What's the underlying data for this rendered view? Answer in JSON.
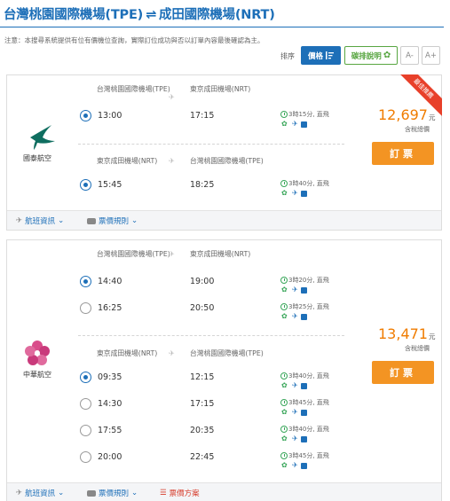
{
  "header": {
    "origin": "台灣桃園國際機場(TPE)",
    "swap_symbol": "⇌",
    "destination": "成田國際機場(NRT)"
  },
  "notice": "注意：本搜尋系統提供有位有價機位查詢，實際訂位成功與否以訂單內容最後確認為主。",
  "sort": {
    "label": "排序",
    "price_label": "價格",
    "eco_label": "碳排說明",
    "font_small": "A-",
    "font_large": "A+"
  },
  "results": [
    {
      "airline": "國泰航空",
      "ribbon": "最佳推薦",
      "price": "12,697",
      "currency": "元",
      "tax_note": "含稅總價",
      "book_label": "訂票",
      "outbound": {
        "from": "台灣桃園國際機場(TPE)",
        "to": "東京成田機場(NRT)",
        "options": [
          {
            "dep": "13:00",
            "arr": "17:15",
            "duration": "3時15分, 直飛",
            "selected": true
          }
        ]
      },
      "inbound": {
        "from": "東京成田機場(NRT)",
        "to": "台灣桃園國際機場(TPE)",
        "options": [
          {
            "dep": "15:45",
            "arr": "18:25",
            "duration": "3時40分, 直飛",
            "selected": true
          }
        ]
      },
      "footer": {
        "flight_info": "航班資訊",
        "fare_rules": "票價規則"
      }
    },
    {
      "airline": "中華航空",
      "price": "13,471",
      "currency": "元",
      "tax_note": "含稅總價",
      "book_label": "訂票",
      "outbound": {
        "from": "台灣桃園國際機場(TPE)",
        "to": "東京成田機場(NRT)",
        "options": [
          {
            "dep": "14:40",
            "arr": "19:00",
            "duration": "3時20分, 直飛",
            "selected": true
          },
          {
            "dep": "16:25",
            "arr": "20:50",
            "duration": "3時25分, 直飛",
            "selected": false
          }
        ]
      },
      "inbound": {
        "from": "東京成田機場(NRT)",
        "to": "台灣桃園國際機場(TPE)",
        "options": [
          {
            "dep": "09:35",
            "arr": "12:15",
            "duration": "3時40分, 直飛",
            "selected": true
          },
          {
            "dep": "14:30",
            "arr": "17:15",
            "duration": "3時45分, 直飛",
            "selected": false
          },
          {
            "dep": "17:55",
            "arr": "20:35",
            "duration": "3時40分, 直飛",
            "selected": false
          },
          {
            "dep": "20:00",
            "arr": "22:45",
            "duration": "3時45分, 直飛",
            "selected": false
          }
        ]
      },
      "footer": {
        "flight_info": "航班資訊",
        "fare_rules": "票價規則",
        "fare_options": "票價方案"
      }
    }
  ],
  "colors": {
    "brand": "#1d6fb8",
    "price": "#f07c00",
    "book": "#f39423",
    "eco": "#58a641",
    "ribbon": "#e8402a"
  }
}
